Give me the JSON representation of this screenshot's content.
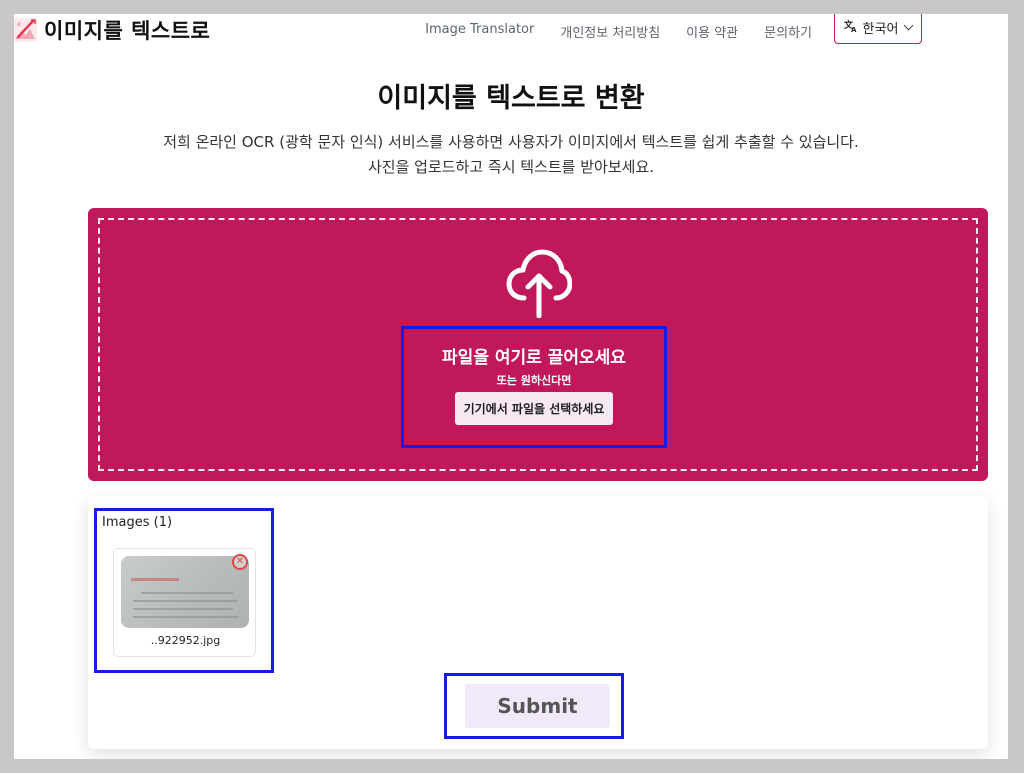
{
  "header": {
    "app_title": "이미지를 텍스트로",
    "nav": [
      "Image Translator",
      "개인정보 처리방침",
      "이용 약관",
      "문의하기"
    ],
    "language": "한국어",
    "language_icon": "translate-icon"
  },
  "hero": {
    "title": "이미지를 텍스트로 변환",
    "subtitle_line1": "저희 온라인 OCR (광학 문자 인식) 서비스를 사용하면 사용자가 이미지에서 텍스트를 쉽게 추출할 수 있습니다.",
    "subtitle_line2": "사진을 업로드하고 즉시 텍스트를 받아보세요."
  },
  "dropzone": {
    "main_text": "파일을 여기로 끌어오세요",
    "or_text": "또는 원하신다면",
    "choose_button": "기기에서 파일을 선택하세요",
    "icon": "cloud-upload-icon",
    "background_color": "#c0185b"
  },
  "images": {
    "label": "Images (1)",
    "files": [
      {
        "filename": "..922952.jpg"
      }
    ]
  },
  "submit_label": "Submit",
  "colors": {
    "brand": "#c0185b",
    "highlight_border": "#1a1ae6",
    "submit_bg": "#f2e8fb"
  }
}
